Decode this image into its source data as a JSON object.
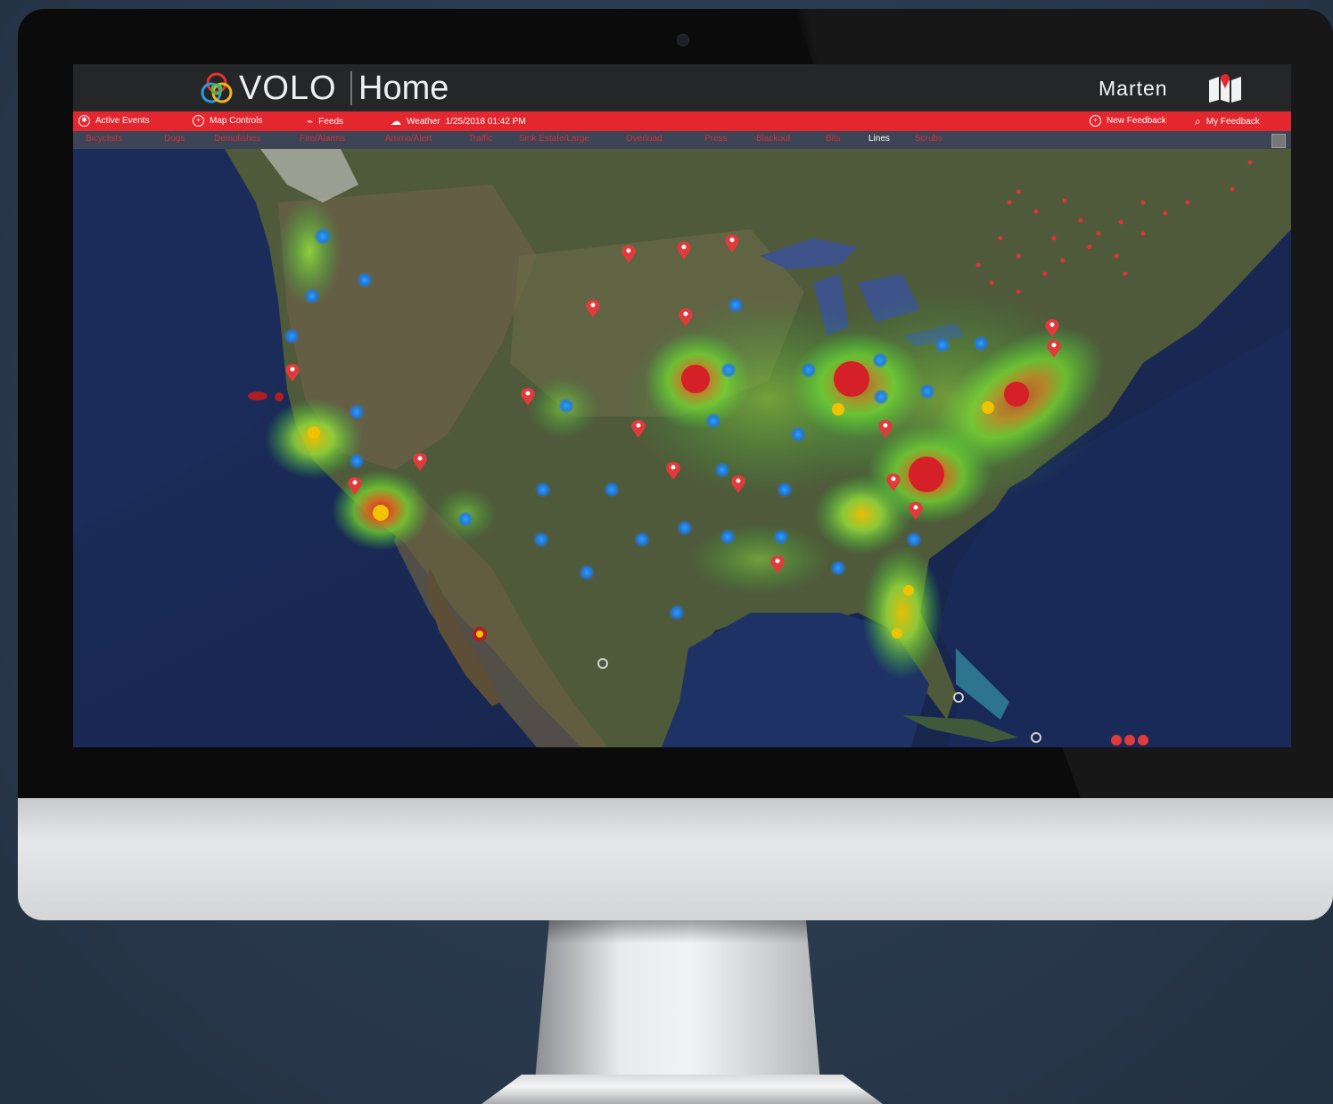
{
  "app": {
    "name": "VOLO",
    "page": "Home",
    "user": "Marten"
  },
  "toolbar": {
    "active_events": "Active Events",
    "map_controls": "Map Controls",
    "feeds": "Feeds",
    "weather": "Weather",
    "weather_time": "1/25/2018 01:42 PM",
    "new_feedback": "New Feedback",
    "my_feedback": "My Feedback"
  },
  "filters": [
    {
      "label": "Bicyclists",
      "active": false
    },
    {
      "label": "Dogs",
      "active": false
    },
    {
      "label": "Demolishes",
      "active": false
    },
    {
      "label": "Fire/Alarms",
      "active": false
    },
    {
      "label": "Ammo/Alert",
      "active": false
    },
    {
      "label": "Traffic",
      "active": false
    },
    {
      "label": "Sink Estate/Large",
      "active": false
    },
    {
      "label": "Overload",
      "active": false
    },
    {
      "label": "Press",
      "active": false
    },
    {
      "label": "Blackout",
      "active": false
    },
    {
      "label": "Bits",
      "active": false
    },
    {
      "label": "Lines",
      "active": true
    },
    {
      "label": "Scrubs",
      "active": false
    }
  ],
  "colors": {
    "accent_red": "#e4262f",
    "header_bg": "#252628",
    "cluster_blue": "#1e90ff",
    "heat_green": "#5fd23a",
    "heat_red": "#d8202a",
    "heat_yellow": "#f2c200"
  },
  "icons": {
    "active_events": "radar-icon",
    "map_controls": "crosshair-icon",
    "feeds": "satellite-icon",
    "weather": "cloud-icon",
    "new_feedback": "plus-circle-icon",
    "my_feedback": "search-icon",
    "user": "user-map-icon"
  }
}
